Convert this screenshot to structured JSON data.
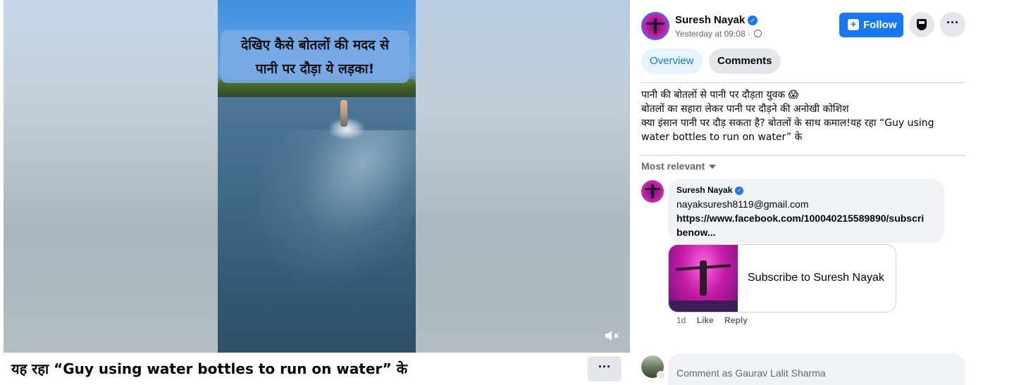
{
  "video": {
    "overlay_text_line1": "देखिए कैसे बोतलों की मदद से",
    "overlay_text_line2": "पानी पर दौड़ा ये लड़का!",
    "mute_icon": "speaker-muted-icon"
  },
  "caption_bar": {
    "title": "यह रहा “Guy using water bottles to run on water” के",
    "more_label": "···"
  },
  "post": {
    "author": "Suresh Nayak",
    "verified": true,
    "time": "Yesterday at 09:08 ·",
    "follow_label": "Follow",
    "more_label": "···",
    "tabs": [
      {
        "label": "Overview",
        "active": true
      },
      {
        "label": "Comments",
        "active": false
      }
    ],
    "text_lines": [
      "पानी की बोतलों से पानी पर दौड़ता युवक 😱",
      "बोतलों का सहारा लेकर पानी पर दौड़ने की अनोखी कोशिश",
      "क्या इंसान पानी पर दौड़ सकता है? बोतलों के साथ कमाल!यह रहा “Guy using",
      "water bottles to run on water” के"
    ]
  },
  "comments": {
    "sort_label": "Most relevant",
    "items": [
      {
        "author": "Suresh Nayak",
        "verified": true,
        "email": "nayaksuresh8119@gmail.com",
        "link_line1": "https://www.facebook.com/100040215589890/subscri",
        "link_line2": "benow...",
        "card_title": "Subscribe to Suresh Nayak",
        "age": "1d",
        "like_label": "Like",
        "reply_label": "Reply"
      }
    ],
    "input_placeholder": "Comment as Gaurav Lalit Sharma"
  },
  "colors": {
    "accent": "#1877f2",
    "bubble": "#f0f2f5",
    "muted_text": "#65676b"
  }
}
